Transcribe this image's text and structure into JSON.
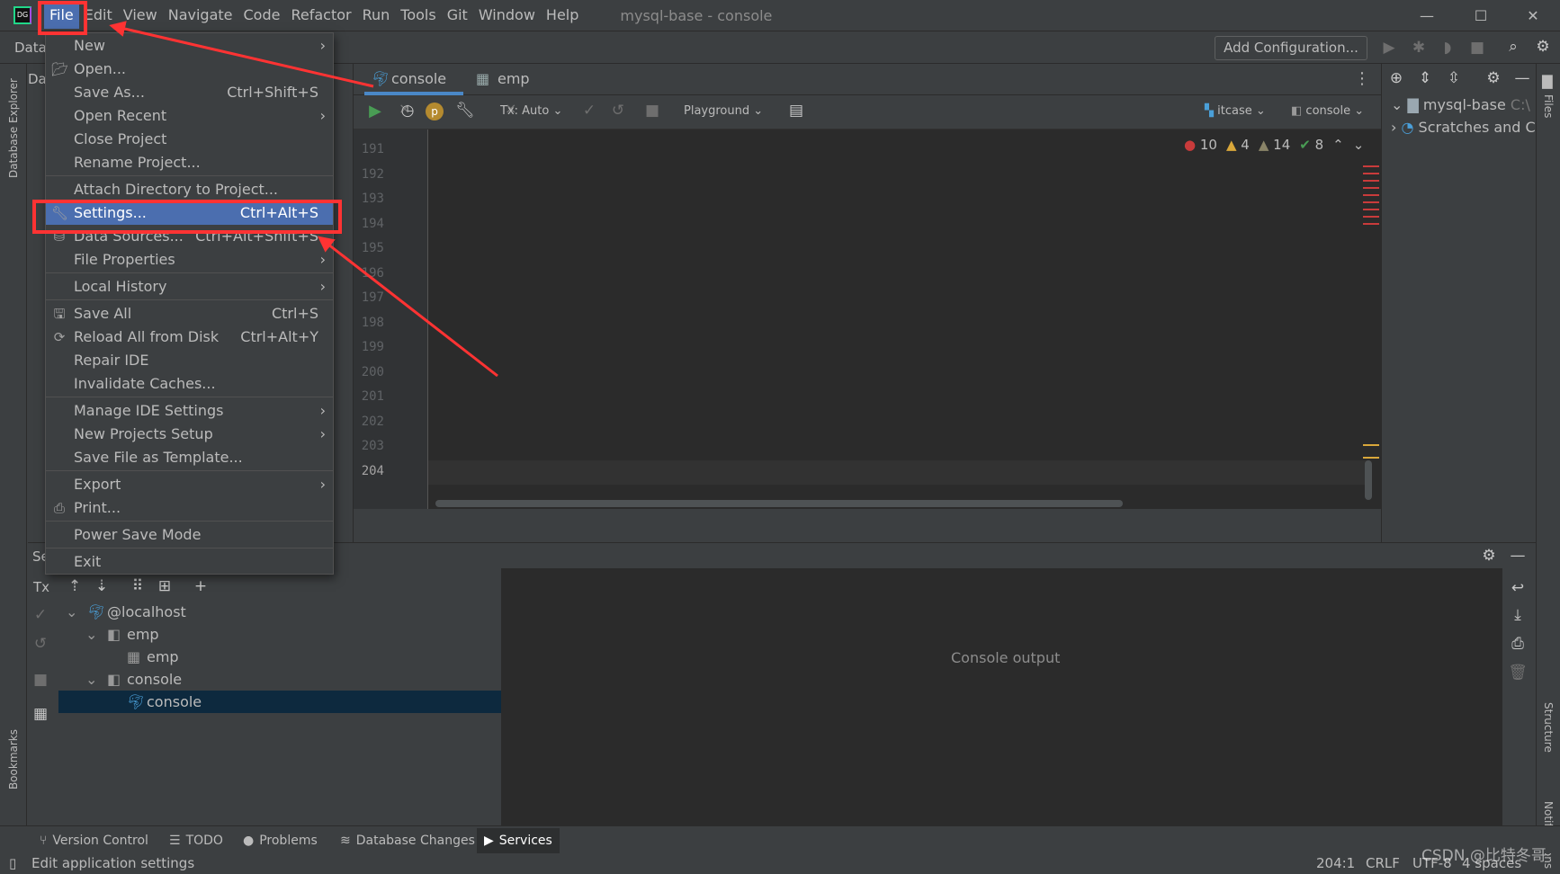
{
  "menubar": {
    "items": [
      "File",
      "Edit",
      "View",
      "Navigate",
      "Code",
      "Refactor",
      "Run",
      "Tools",
      "Git",
      "Window",
      "Help"
    ],
    "active": "File",
    "title": "mysql-base - console",
    "logo": "DG"
  },
  "window_controls": {
    "minimize": "—",
    "maximize": "☐",
    "close": "✕"
  },
  "toolbar": {
    "db_label": "Data",
    "add_config": "Add Configuration..."
  },
  "db_panel": {
    "header": "Da"
  },
  "left_strip": {
    "database_explorer": "Database Explorer",
    "bookmarks": "Bookmarks"
  },
  "right_strip": {
    "files": "Files",
    "structure": "Structure",
    "notifications": "Notifications"
  },
  "editor": {
    "tabs": [
      {
        "label": "console",
        "active": true
      },
      {
        "label": "emp",
        "active": false
      }
    ],
    "toolbar": {
      "tx": "Tx: Auto",
      "playground": "Playground",
      "schema": "itcase",
      "session": "console"
    },
    "line_numbers": [
      "191",
      "192",
      "193",
      "194",
      "195",
      "196",
      "197",
      "198",
      "199",
      "200",
      "201",
      "202",
      "203",
      "204"
    ],
    "current_line": "204",
    "inspections": {
      "errors": "10",
      "warnings": "4",
      "weak_warnings": "14",
      "ok": "8"
    }
  },
  "project": {
    "items": [
      {
        "label": "mysql-base",
        "path": "C:\\"
      },
      {
        "label": "Scratches and C"
      }
    ]
  },
  "services": {
    "header": "Se",
    "tx": "Tx",
    "tree": [
      {
        "label": "@localhost",
        "level": 0
      },
      {
        "label": "emp",
        "level": 1
      },
      {
        "label": "emp",
        "level": 2
      },
      {
        "label": "console",
        "level": 1
      },
      {
        "label": "console",
        "level": 2,
        "selected": true
      }
    ],
    "console_placeholder": "Console output"
  },
  "file_menu": {
    "items": [
      {
        "label": "New",
        "submenu": true
      },
      {
        "label": "Open...",
        "icon": "folder-open-icon"
      },
      {
        "label": "Save As...",
        "shortcut": "Ctrl+Shift+S"
      },
      {
        "label": "Open Recent",
        "submenu": true
      },
      {
        "label": "Close Project"
      },
      {
        "label": "Rename Project..."
      },
      {
        "sep": true
      },
      {
        "label": "Attach Directory to Project..."
      },
      {
        "label": "Settings...",
        "shortcut": "Ctrl+Alt+S",
        "icon": "wrench-icon",
        "highlighted": true
      },
      {
        "label": "Data Sources...",
        "shortcut": "Ctrl+Alt+Shift+S",
        "icon": "data-sources-icon"
      },
      {
        "label": "File Properties",
        "submenu": true
      },
      {
        "sep": true
      },
      {
        "label": "Local History",
        "submenu": true
      },
      {
        "sep": true
      },
      {
        "label": "Save All",
        "shortcut": "Ctrl+S",
        "icon": "save-icon"
      },
      {
        "label": "Reload All from Disk",
        "shortcut": "Ctrl+Alt+Y",
        "icon": "reload-icon"
      },
      {
        "label": "Repair IDE"
      },
      {
        "label": "Invalidate Caches..."
      },
      {
        "sep": true
      },
      {
        "label": "Manage IDE Settings",
        "submenu": true
      },
      {
        "label": "New Projects Setup",
        "submenu": true
      },
      {
        "label": "Save File as Template..."
      },
      {
        "sep": true
      },
      {
        "label": "Export",
        "submenu": true
      },
      {
        "label": "Print...",
        "icon": "print-icon"
      },
      {
        "sep": true
      },
      {
        "label": "Power Save Mode"
      },
      {
        "sep": true
      },
      {
        "label": "Exit"
      }
    ]
  },
  "bottom_tabs": [
    {
      "label": "Version Control",
      "icon": "⑂"
    },
    {
      "label": "TODO",
      "icon": "☰"
    },
    {
      "label": "Problems",
      "icon": "●"
    },
    {
      "label": "Database Changes",
      "icon": "≋"
    },
    {
      "label": "Services",
      "icon": "▶",
      "active": true
    }
  ],
  "status": {
    "message": "Edit application settings",
    "position": "204:1",
    "line_sep": "CRLF",
    "encoding": "UTF-8",
    "indent": "4 spaces",
    "watermark": "CSDN @比特冬哥"
  },
  "colors": {
    "accent": "#4b6eaf",
    "annotation": "#ff3333",
    "error": "#c93b3b",
    "warning": "#d9a73a"
  }
}
